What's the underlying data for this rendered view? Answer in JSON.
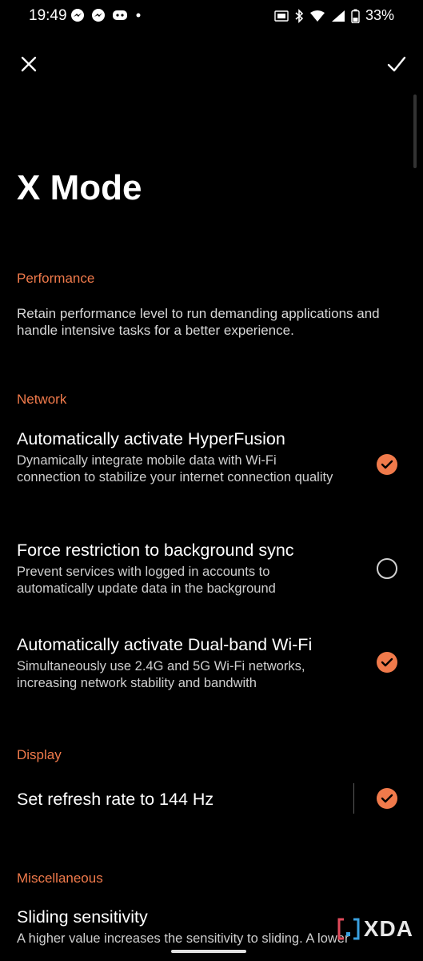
{
  "status": {
    "time": "19:49",
    "battery": "33%",
    "left_icons": [
      "messenger-icon",
      "messenger-icon",
      "discord-icon",
      "dot-icon"
    ],
    "right_icons": [
      "hd-icon",
      "bluetooth-icon",
      "wifi-icon",
      "signal-icon",
      "battery-icon"
    ]
  },
  "page": {
    "title": "X Mode"
  },
  "sections": {
    "performance": {
      "header": "Performance",
      "description": "Retain performance level to run demanding applications and handle intensive tasks for a better experience."
    },
    "network": {
      "header": "Network",
      "items": [
        {
          "title": "Automatically activate HyperFusion",
          "subtitle": "Dynamically integrate mobile data with Wi-Fi connection to stabilize your internet connection quality",
          "checked": true
        },
        {
          "title": "Force restriction to background sync",
          "subtitle": "Prevent services with logged in accounts to automatically update data in the background",
          "checked": false
        },
        {
          "title": "Automatically activate Dual-band Wi-Fi",
          "subtitle": "Simultaneously use 2.4G and 5G Wi-Fi networks, increasing network stability and bandwith",
          "checked": true
        }
      ]
    },
    "display": {
      "header": "Display",
      "items": [
        {
          "title": "Set refresh rate to 144 Hz",
          "checked": true
        }
      ]
    },
    "misc": {
      "header": "Miscellaneous",
      "items": [
        {
          "title": "Sliding sensitivity",
          "subtitle": "A higher value increases the sensitivity to sliding. A lower"
        }
      ]
    }
  },
  "watermark": {
    "text": "XDA"
  },
  "colors": {
    "accent": "#f07a4b",
    "background": "#000000"
  }
}
